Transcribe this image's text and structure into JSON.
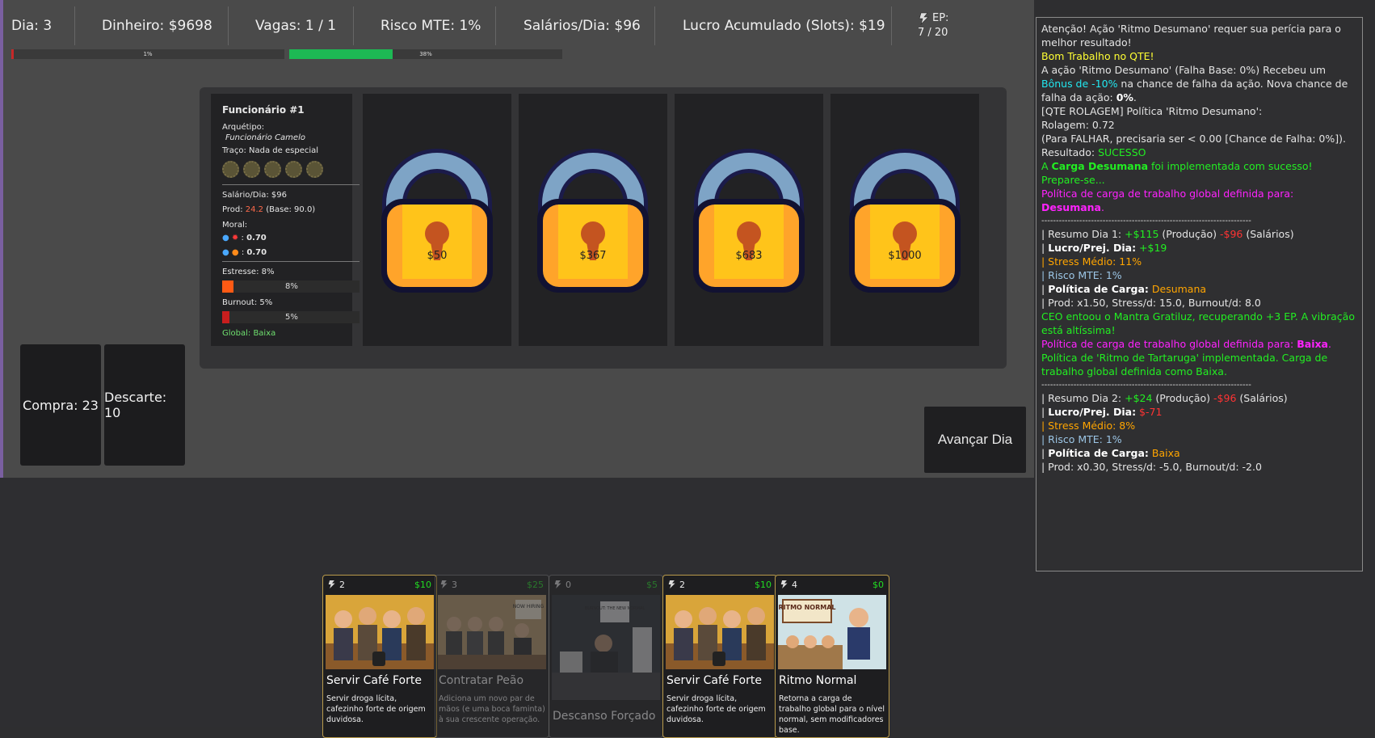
{
  "stats": {
    "day": "Dia: 3",
    "money": "Dinheiro: $9698",
    "slots": "Vagas: 1 / 1",
    "risk": "Risco MTE: 1%",
    "salaries": "Salários/Dia: $96",
    "profit": "Lucro Acumulado (Slots): $19",
    "ep_label": "EP:",
    "ep_value": "7 / 20"
  },
  "bars": {
    "risk": {
      "label": "1%",
      "value": 0.01,
      "color": "#c62828"
    },
    "progress": {
      "label": "38%",
      "value": 0.38,
      "color": "#1db954"
    }
  },
  "employee": {
    "title": "Funcionário #1",
    "archetype_label": "Arquétipo:",
    "archetype": "Funcionário Camelo",
    "trait": "Traço: Nada de especial",
    "salary": "Salário/Dia: $96",
    "prod_label": "Prod:",
    "prod_value": "24.2",
    "prod_base": "(Base: 90.0)",
    "moral_label": "Moral:",
    "moral_1": "0.70",
    "moral_2": "0.70",
    "stress_label": "Estresse: 8%",
    "stress_pct": "8%",
    "stress_value": 0.08,
    "burnout_label": "Burnout: 5%",
    "burnout_pct": "5%",
    "burnout_value": 0.05,
    "global": "Global: Baixa"
  },
  "locked_slots": [
    {
      "price": "$50"
    },
    {
      "price": "$367"
    },
    {
      "price": "$683"
    },
    {
      "price": "$1000"
    }
  ],
  "piles": {
    "draw": "Compra: 23",
    "discard": "Descarte: 10"
  },
  "advance_button": "Avançar Dia",
  "log": {
    "l1": "Atenção! Ação 'Ritmo Desumano' requer sua perícia para o melhor resultado!",
    "l2": "Bom Trabalho no QTE!",
    "l3a": " A ação 'Ritmo Desumano' (Falha Base: 0%) Recebeu um ",
    "l3b": "Bônus de -10%",
    "l3c": " na chance de falha da ação. Nova chance de falha da ação: ",
    "l3d": "0%",
    "l3e": ".",
    "l4": "[QTE ROLAGEM] Política 'Ritmo Desumano':",
    "l5": "Rolagem: 0.72",
    "l6": "(Para FALHAR, precisaria ser < 0.00 [Chance de Falha: 0%]).",
    "l7a": "Resultado: ",
    "l7b": "SUCESSO",
    "l8a": "A ",
    "l8b": "Carga Desumana",
    "l8c": " foi implementada com sucesso! Prepare-se...",
    "l9a": "Política de carga de trabalho global definida para: ",
    "l9b": "Desumana",
    "l9c": ".",
    "sep": "------------------------------------------------------------------------",
    "d1a": "| Resumo Dia 1: ",
    "d1b": "+$115",
    "d1c": " (Produção) ",
    "d1d": "-$96",
    "d1e": " (Salários)",
    "d1f": "| ",
    "d1g": "Lucro/Prej. Dia:",
    "d1h": " +$19",
    "d1i": "| Stress Médio: 11%",
    "d1j": "| Risco MTE: 1%",
    "d1k": "| ",
    "d1l": "Política de Carga:",
    "d1m": " Desumana",
    "d1n": "|   Prod: x1.50, Stress/d: 15.0, Burnout/d: 8.0",
    "ceo": "CEO entoou o Mantra Gratiluz, recuperando +3 EP. A vibração está altíssima!",
    "p2a": "Política de carga de trabalho global definida para: ",
    "p2b": "Baixa",
    "p2c": ".",
    "tart": "Política de 'Ritmo de Tartaruga' implementada. Carga de trabalho global definida como Baixa.",
    "d2a": "| Resumo Dia 2: ",
    "d2b": "+$24",
    "d2c": " (Produção) ",
    "d2d": "-$96",
    "d2e": " (Salários)",
    "d2f": "| ",
    "d2g": "Lucro/Prej. Dia:",
    "d2h": " $-71",
    "d2i": "| Stress Médio: 8%",
    "d2j": "| Risco MTE: 1%",
    "d2k": "| ",
    "d2l": "Política de Carga:",
    "d2m": " Baixa",
    "d2n": "|   Prod: x0.30, Stress/d: -5.0, Burnout/d: -2.0"
  },
  "hand": [
    {
      "cost": "2",
      "price": "$10",
      "name": "Servir Café Forte",
      "desc": "Servir droga lícita, cafezinho forte de origem duvidosa.",
      "dim": false
    },
    {
      "cost": "3",
      "price": "$25",
      "name": "Contratar Peão",
      "desc": "Adiciona um novo par de mãos (e uma boca faminta) à sua crescente operação.",
      "dim": true
    },
    {
      "cost": "0",
      "price": "$5",
      "name": "Descanso Forçado",
      "desc": "",
      "dim": true
    },
    {
      "cost": "2",
      "price": "$10",
      "name": "Servir Café Forte",
      "desc": "Servir droga lícita, cafezinho forte de origem duvidosa.",
      "dim": false
    },
    {
      "cost": "4",
      "price": "$0",
      "name": "Ritmo Normal",
      "desc": "Retorna a carga de trabalho global para o nível normal, sem modificadores base.",
      "dim": false
    }
  ],
  "art_text": {
    "now_hiring": "NOW HIRING",
    "burnout_sign": "BURNOUT: THE NEW NORMAL",
    "ritmo_sign": "RITMO NORMAL"
  },
  "colors": {
    "stress": "#ff5a14",
    "burnout": "#c81e1e",
    "prod_value": "#ff6a4a",
    "global": "#6fe06f"
  }
}
